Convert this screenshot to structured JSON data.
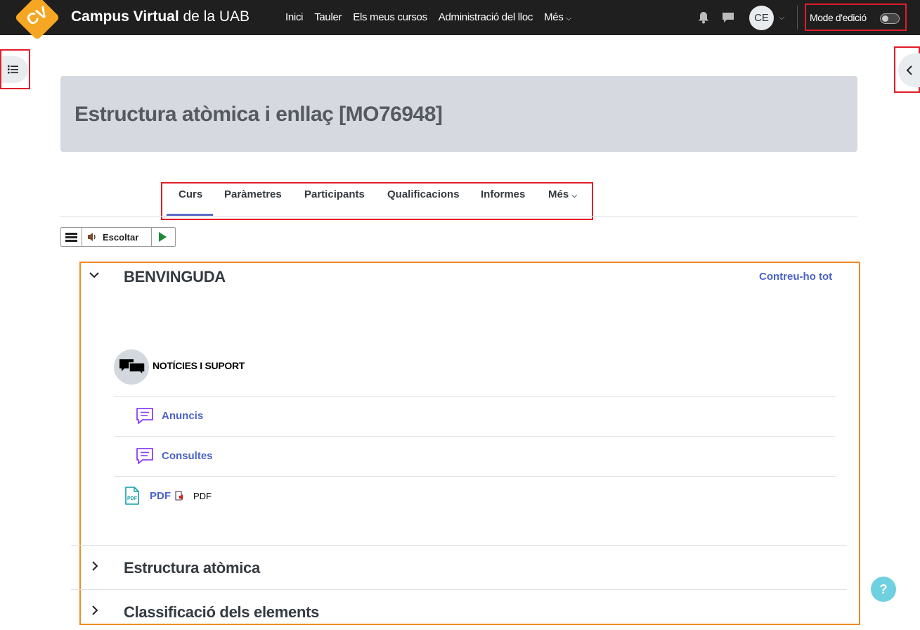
{
  "app": {
    "logo_text": "CV",
    "brand_bold": "Campus Virtual",
    "brand_rest": "de la UAB"
  },
  "nav": {
    "items": [
      "Inici",
      "Tauler",
      "Els meus cursos",
      "Administració del lloc",
      "Més"
    ]
  },
  "user": {
    "initials": "CE",
    "edit_mode_label": "Mode d'edició",
    "edit_mode_on": false
  },
  "course": {
    "title": "Estructura atòmica i enllaç [MO76948]"
  },
  "tabs": [
    {
      "label": "Curs",
      "active": true
    },
    {
      "label": "Paràmetres",
      "active": false
    },
    {
      "label": "Participants",
      "active": false
    },
    {
      "label": "Qualificacions",
      "active": false
    },
    {
      "label": "Informes",
      "active": false
    },
    {
      "label": "Més",
      "active": false
    }
  ],
  "tts": {
    "listen_label": "Escoltar"
  },
  "sections": {
    "collapse_all_label": "Contreu-ho tot",
    "items": [
      {
        "title": "BENVINGUDA",
        "expanded": true
      },
      {
        "title": "Estructura atòmica",
        "expanded": false
      },
      {
        "title": "Classificació dels elements",
        "expanded": false
      }
    ],
    "subsection_title": "NOTÍCIES I SUPORT",
    "activities": [
      {
        "label": "Anuncis",
        "icon": "forum-icon"
      },
      {
        "label": "Consultes",
        "icon": "forum-icon"
      },
      {
        "label": "PDF",
        "icon": "pdf-icon",
        "note": "PDF"
      }
    ]
  },
  "help_label": "?",
  "colors": {
    "topbar": "#1f1f1f",
    "accent": "#4a62c9",
    "forum_icon": "#8a3ffc",
    "pdf_icon": "#0f9fa8",
    "header_bg": "#d7d9e0",
    "help_bg": "#6fd1e0"
  }
}
